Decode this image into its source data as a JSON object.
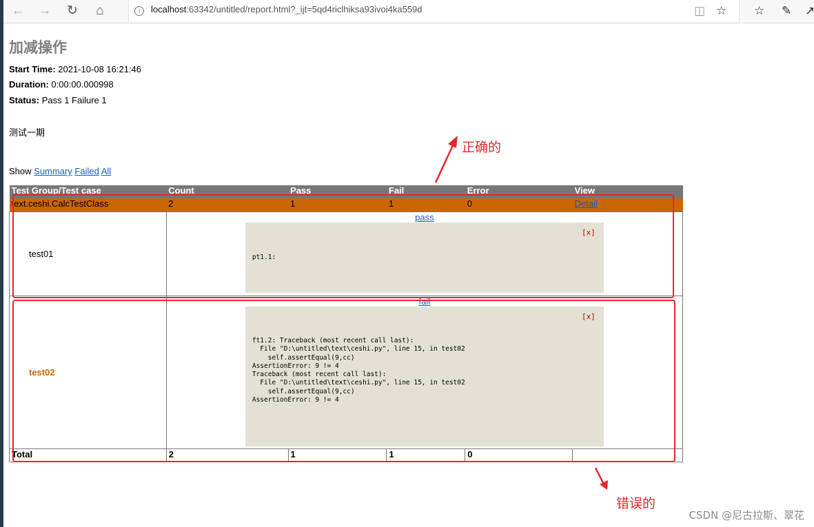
{
  "browser": {
    "url_host": "localhost",
    "url_rest": ":63342/untitled/report.html?_ijt=5qd4riclhiksa93ivoi4ka559d"
  },
  "report": {
    "title": "加减操作",
    "start_time_label": "Start Time:",
    "start_time": "2021-10-08 16:21:46",
    "duration_label": "Duration:",
    "duration": "0:00:00.000998",
    "status_label": "Status:",
    "status": "Pass 1 Failure 1",
    "description": "测试一期"
  },
  "show": {
    "label": "Show",
    "summary": "Summary",
    "failed": "Failed",
    "all": "All"
  },
  "table": {
    "headers": [
      "Test Group/Test case",
      "Count",
      "Pass",
      "Fail",
      "Error",
      "View"
    ],
    "group": {
      "name": "text.ceshi.CalcTestClass",
      "count": "2",
      "pass": "1",
      "fail": "1",
      "error": "0",
      "view": "Detail"
    },
    "tests": [
      {
        "name": "test01",
        "status_link": "pass",
        "close": "[x]",
        "output": "pt1.1:"
      },
      {
        "name": "test02",
        "status_link": "fail",
        "close": "[x]",
        "output": "ft1.2: Traceback (most recent call last):\n  File \"D:\\untitled\\text\\ceshi.py\", line 15, in test02\n    self.assertEqual(9,cc)\nAssertionError: 9 != 4\nTraceback (most recent call last):\n  File \"D:\\untitled\\text\\ceshi.py\", line 15, in test02\n    self.assertEqual(9,cc)\nAssertionError: 9 != 4"
      }
    ],
    "total": {
      "label": "Total",
      "count": "2",
      "pass": "1",
      "fail": "1",
      "error": "0"
    }
  },
  "annotations": {
    "correct": "正确的",
    "wrong": "错误的",
    "color": "#e6262a"
  },
  "watermark": "CSDN @尼古拉斯、翠花"
}
